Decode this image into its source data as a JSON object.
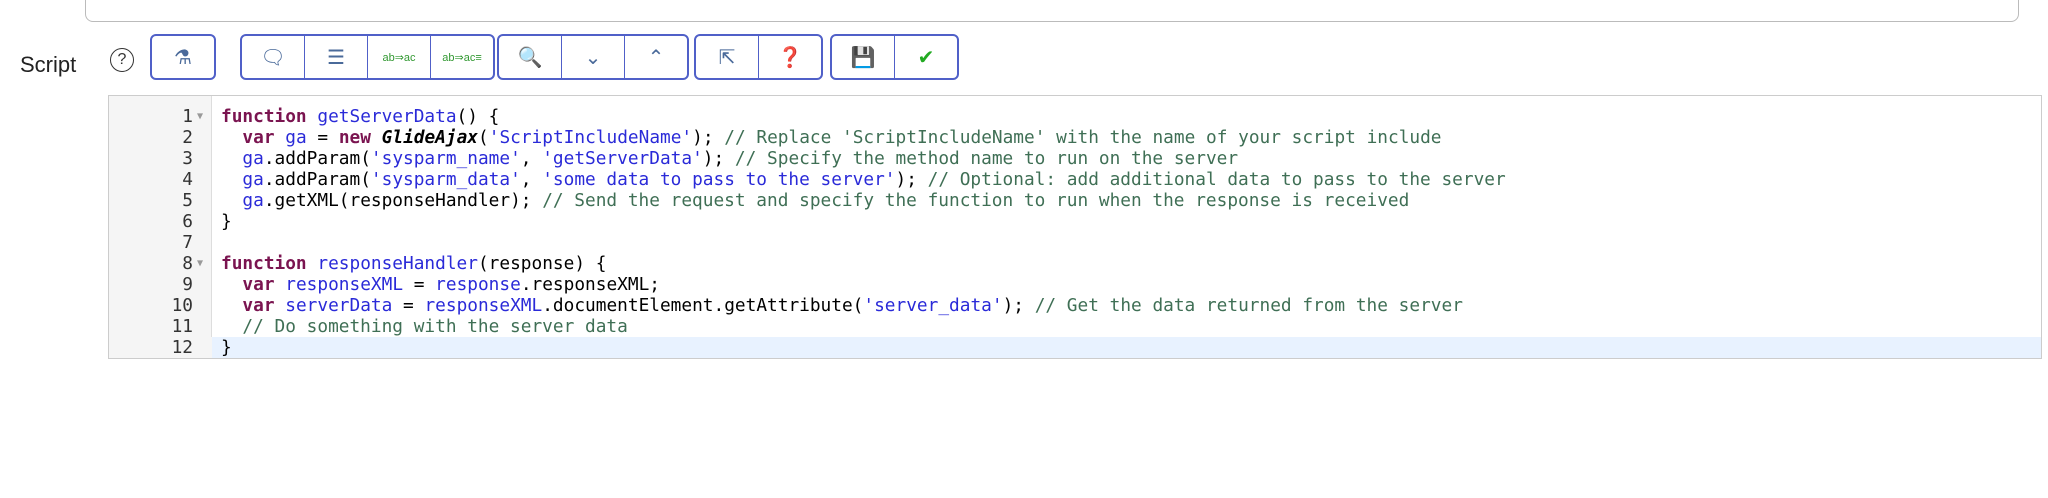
{
  "field_label": "Script",
  "help_icon": "?",
  "toolbar": {
    "groups": [
      [
        "script-debugger"
      ],
      [
        "comment",
        "format",
        "replace",
        "replace-all"
      ],
      [
        "search",
        "next",
        "previous"
      ],
      [
        "fullscreen",
        "help"
      ],
      [
        "save",
        "syntax-check"
      ]
    ]
  },
  "code": [
    {
      "n": "1",
      "fold": true,
      "tokens": [
        [
          "kw",
          "function"
        ],
        [
          "",
          " "
        ],
        [
          "fn",
          "getServerData"
        ],
        [
          "",
          "() {"
        ]
      ]
    },
    {
      "n": "2",
      "tokens": [
        [
          "",
          "  "
        ],
        [
          "kw",
          "var"
        ],
        [
          "",
          " "
        ],
        [
          "fn",
          "ga"
        ],
        [
          "",
          " = "
        ],
        [
          "kw",
          "new"
        ],
        [
          "",
          " "
        ],
        [
          "cls",
          "GlideAjax"
        ],
        [
          "",
          "("
        ],
        [
          "str",
          "'ScriptIncludeName'"
        ],
        [
          "",
          "); "
        ],
        [
          "cm",
          "// Replace 'ScriptIncludeName' with the name of your script include"
        ]
      ]
    },
    {
      "n": "3",
      "tokens": [
        [
          "",
          "  "
        ],
        [
          "fn",
          "ga"
        ],
        [
          "",
          ".addParam("
        ],
        [
          "str",
          "'sysparm_name'"
        ],
        [
          "",
          ", "
        ],
        [
          "str",
          "'getServerData'"
        ],
        [
          "",
          "); "
        ],
        [
          "cm",
          "// Specify the method name to run on the server"
        ]
      ]
    },
    {
      "n": "4",
      "tokens": [
        [
          "",
          "  "
        ],
        [
          "fn",
          "ga"
        ],
        [
          "",
          ".addParam("
        ],
        [
          "str",
          "'sysparm_data'"
        ],
        [
          "",
          ", "
        ],
        [
          "str",
          "'some data to pass to the server'"
        ],
        [
          "",
          "); "
        ],
        [
          "cm",
          "// Optional: add additional data to pass to the server"
        ]
      ]
    },
    {
      "n": "5",
      "tokens": [
        [
          "",
          "  "
        ],
        [
          "fn",
          "ga"
        ],
        [
          "",
          ".getXML(responseHandler); "
        ],
        [
          "cm",
          "// Send the request and specify the function to run when the response is received"
        ]
      ]
    },
    {
      "n": "6",
      "tokens": [
        [
          "",
          "}"
        ]
      ]
    },
    {
      "n": "7",
      "tokens": []
    },
    {
      "n": "8",
      "fold": true,
      "tokens": [
        [
          "kw",
          "function"
        ],
        [
          "",
          " "
        ],
        [
          "fn",
          "responseHandler"
        ],
        [
          "",
          "(response) {"
        ]
      ]
    },
    {
      "n": "9",
      "tokens": [
        [
          "",
          "  "
        ],
        [
          "kw",
          "var"
        ],
        [
          "",
          " "
        ],
        [
          "fn",
          "responseXML"
        ],
        [
          "",
          " = "
        ],
        [
          "fn",
          "response"
        ],
        [
          "",
          ".responseXML;"
        ]
      ]
    },
    {
      "n": "10",
      "tokens": [
        [
          "",
          "  "
        ],
        [
          "kw",
          "var"
        ],
        [
          "",
          " "
        ],
        [
          "fn",
          "serverData"
        ],
        [
          "",
          " = "
        ],
        [
          "fn",
          "responseXML"
        ],
        [
          "",
          ".documentElement.getAttribute("
        ],
        [
          "str",
          "'server_data'"
        ],
        [
          "",
          "); "
        ],
        [
          "cm",
          "// Get the data returned from the server"
        ]
      ]
    },
    {
      "n": "11",
      "tokens": [
        [
          "",
          "  "
        ],
        [
          "cm",
          "// Do something with the server data"
        ]
      ]
    },
    {
      "n": "12",
      "hl": true,
      "tokens": [
        [
          "",
          "}"
        ]
      ]
    }
  ]
}
